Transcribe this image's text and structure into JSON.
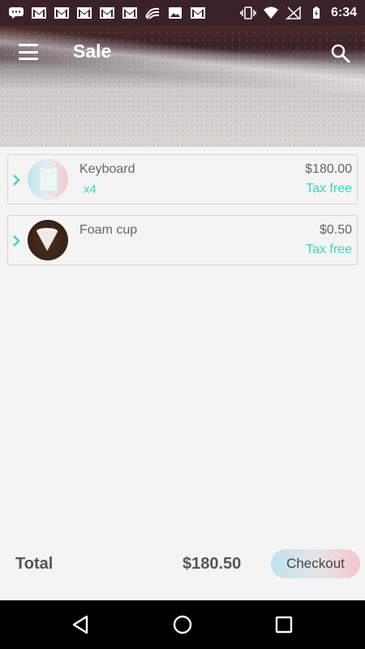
{
  "status_bar": {
    "time": "6:34",
    "left_icons": [
      "chat-icon",
      "gmail-icon",
      "gmail-icon",
      "gmail-icon",
      "gmail-icon",
      "gmail-icon",
      "swiftkey-icon",
      "image-icon",
      "gmail-icon"
    ],
    "right_icons": [
      "vibrate-icon",
      "wifi-icon",
      "no-signal-icon",
      "battery-charging-icon"
    ]
  },
  "header": {
    "title": "Sale",
    "menu_icon": "hamburger-menu-icon",
    "search_icon": "search-icon"
  },
  "items": [
    {
      "name": "Keyboard",
      "qty": "x4",
      "price": "$180.00",
      "tax": "Tax free",
      "thumb": "keyboard-box"
    },
    {
      "name": "Foam cup",
      "qty": "",
      "price": "$0.50",
      "tax": "Tax free",
      "thumb": "foam-cup"
    }
  ],
  "footer": {
    "total_label": "Total",
    "total_value": "$180.50",
    "checkout_label": "Checkout"
  },
  "colors": {
    "accent": "#3fd6b8",
    "status_bar": "#3a2226",
    "nav_bar": "#000000"
  }
}
